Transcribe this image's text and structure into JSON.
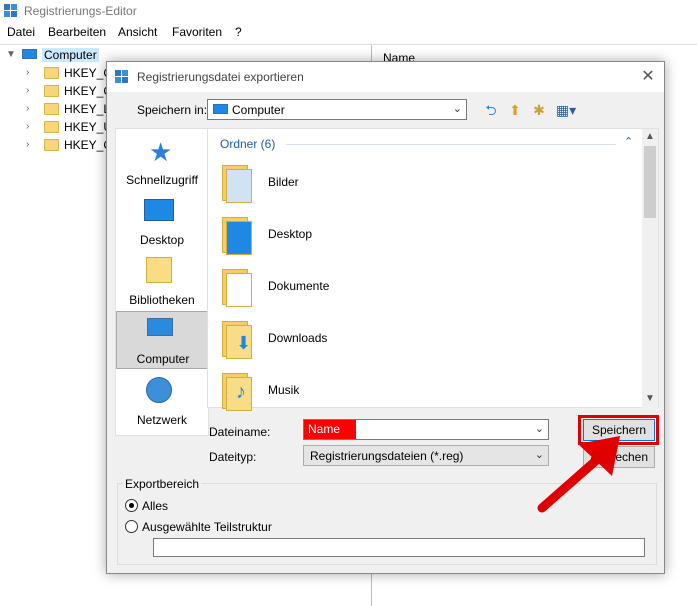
{
  "regedit": {
    "title": "Registrierungs-Editor",
    "menu": [
      "Datei",
      "Bearbeiten",
      "Ansicht",
      "Favoriten",
      "?"
    ],
    "tree_root": "Computer",
    "tree_items": [
      "HKEY_C",
      "HKEY_C",
      "HKEY_L",
      "HKEY_U",
      "HKEY_C"
    ],
    "column_name": "Name"
  },
  "dialog": {
    "title": "Registrierungsdatei exportieren",
    "close_glyph": "✕",
    "save_in_label": "Speichern in:",
    "save_in_value": "Computer",
    "places": [
      "Schnellzugriff",
      "Desktop",
      "Bibliotheken",
      "Computer",
      "Netzwerk"
    ],
    "group_header": "Ordner (6)",
    "files": [
      "Bilder",
      "Desktop",
      "Dokumente",
      "Downloads",
      "Musik"
    ],
    "filename_label": "Dateiname:",
    "filename_value": "Name",
    "filetype_label": "Dateityp:",
    "filetype_value": "Registrierungsdateien (*.reg)",
    "save_button": "Speichern",
    "cancel_button": "Abbrechen",
    "export_title": "Exportbereich",
    "option_all": "Alles",
    "option_branch": "Ausgewählte Teilstruktur"
  },
  "colors": {
    "highlight": "#e00000",
    "accent": "#0078d7"
  }
}
